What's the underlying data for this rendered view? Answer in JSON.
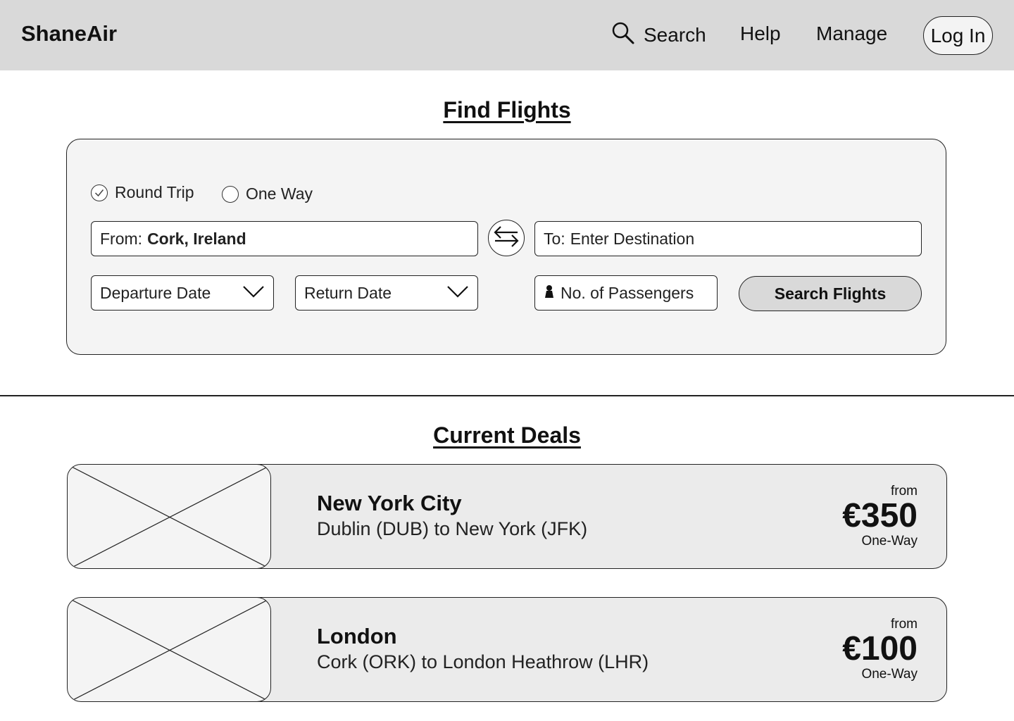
{
  "header": {
    "brand": "ShaneAir",
    "nav": {
      "search": "Search",
      "help": "Help",
      "manage": "Manage"
    },
    "login": "Log In"
  },
  "find_flights": {
    "title": "Find Flights",
    "trip_types": {
      "round_trip": "Round Trip",
      "one_way": "One Way",
      "selected": "Round Trip"
    },
    "from": {
      "label": "From:",
      "value": "Cork, Ireland"
    },
    "to": {
      "label": "To:",
      "placeholder": "Enter Destination"
    },
    "departure_date": "Departure Date",
    "return_date": "Return Date",
    "passengers": "No. of Passengers",
    "submit": "Search Flights"
  },
  "deals": {
    "title": "Current Deals",
    "items": [
      {
        "city": "New York City",
        "route": "Dublin (DUB) to New York (JFK)",
        "from": "from",
        "price": "€350",
        "type": "One-Way"
      },
      {
        "city": "London",
        "route": "Cork (ORK) to London Heathrow (LHR)",
        "from": "from",
        "price": "€100",
        "type": "One-Way"
      }
    ]
  },
  "icons": {
    "search": "search-icon",
    "swap": "swap-arrows-icon",
    "chevron": "chevron-down-icon",
    "person": "person-icon",
    "check": "check-icon",
    "image_placeholder": "image-placeholder-icon"
  }
}
